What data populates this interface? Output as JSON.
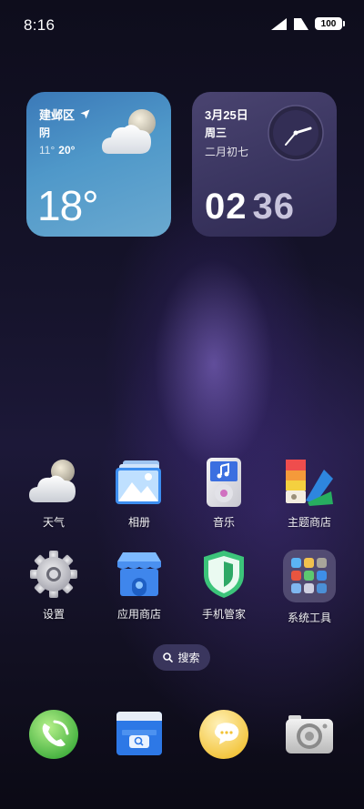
{
  "status_bar": {
    "time": "8:16",
    "battery": "100"
  },
  "weather_widget": {
    "location": "建邺区",
    "condition": "阴",
    "low": "11°",
    "high": "20°",
    "temperature": "18°"
  },
  "clock_widget": {
    "date": "3月25日",
    "weekday": "周三",
    "lunar_date": "二月初七",
    "hour": "02",
    "minute": "36"
  },
  "apps": [
    {
      "label": "天气",
      "icon": "weather-icon"
    },
    {
      "label": "相册",
      "icon": "gallery-icon"
    },
    {
      "label": "音乐",
      "icon": "music-icon"
    },
    {
      "label": "主题商店",
      "icon": "theme-store-icon"
    },
    {
      "label": "设置",
      "icon": "settings-gear-icon"
    },
    {
      "label": "应用商店",
      "icon": "app-store-icon"
    },
    {
      "label": "手机管家",
      "icon": "phone-manager-shield-icon"
    },
    {
      "label": "系统工具",
      "icon": "system-tools-folder-icon"
    }
  ],
  "search": {
    "label": "搜索"
  },
  "dock": [
    {
      "icon": "phone-icon"
    },
    {
      "icon": "browser-icon"
    },
    {
      "icon": "messages-icon"
    },
    {
      "icon": "camera-icon"
    }
  ]
}
